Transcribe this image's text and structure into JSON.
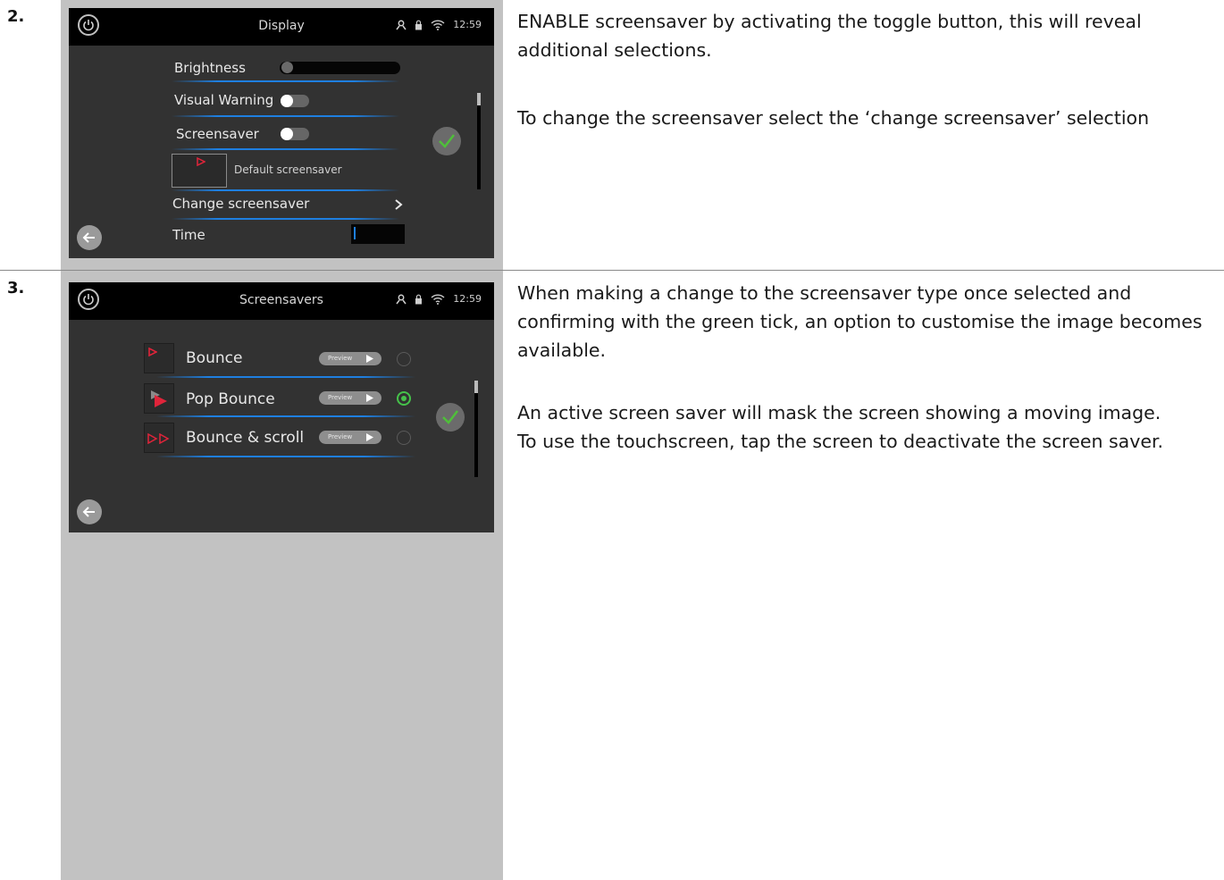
{
  "steps": [
    {
      "number": "2.",
      "screen": {
        "title": "Display",
        "time": "12:59",
        "brightness_label": "Brightness",
        "visual_warning_label": "Visual Warning",
        "screensaver_label": "Screensaver",
        "default_screensaver_label": "Default screensaver",
        "change_screensaver_label": "Change screensaver",
        "time_label": "Time"
      },
      "paragraphs": [
        "ENABLE screensaver by activating the toggle button, this will reveal additional selections.",
        "To change the screensaver select the ‘change screensaver’ selection"
      ]
    },
    {
      "number": "3.",
      "screen": {
        "title": "Screensavers",
        "time": "12:59",
        "preview_label": "Preview",
        "items": [
          {
            "label": "Bounce",
            "selected": false
          },
          {
            "label": "Pop Bounce",
            "selected": true
          },
          {
            "label": "Bounce & scroll",
            "selected": false
          }
        ]
      },
      "paragraphs": [
        "When making a change to the screensaver type once selected and confirming with the green tick, an option to customise the image becomes available.",
        "An active screen saver will mask the screen showing a moving image.",
        "To use the touchscreen, tap the screen to deactivate the screen saver."
      ]
    }
  ],
  "colors": {
    "accent_blue": "#1e7fe0",
    "selected_green": "#45c24a",
    "brand_red": "#e0243a"
  }
}
